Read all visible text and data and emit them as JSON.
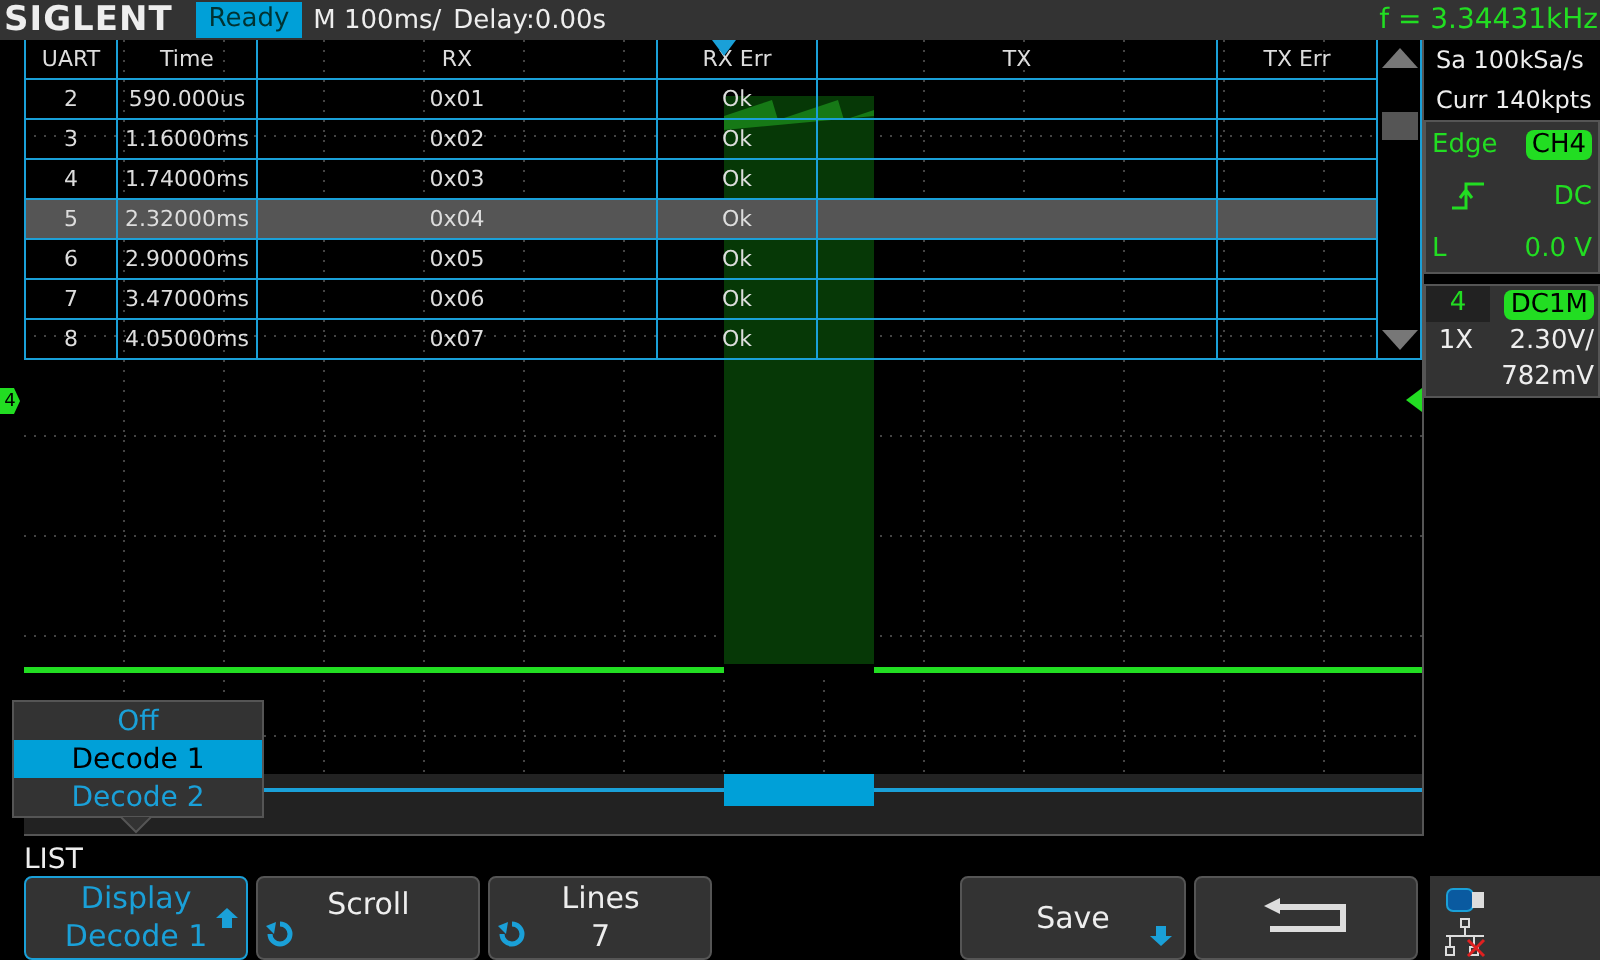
{
  "header": {
    "logo": "SIGLENT",
    "status": "Ready",
    "timebase": "M 100ms/",
    "delay": "Delay:0.00s",
    "frequency": "f = 3.34431kHz"
  },
  "table": {
    "columns": [
      "UART",
      "Time",
      "RX",
      "RX Err",
      "TX",
      "TX Err"
    ],
    "rows": [
      {
        "cells": [
          "2",
          "590.000us",
          "0x01",
          "Ok",
          "",
          ""
        ],
        "selected": false
      },
      {
        "cells": [
          "3",
          "1.16000ms",
          "0x02",
          "Ok",
          "",
          ""
        ],
        "selected": false
      },
      {
        "cells": [
          "4",
          "1.74000ms",
          "0x03",
          "Ok",
          "",
          ""
        ],
        "selected": false
      },
      {
        "cells": [
          "5",
          "2.32000ms",
          "0x04",
          "Ok",
          "",
          ""
        ],
        "selected": true
      },
      {
        "cells": [
          "6",
          "2.90000ms",
          "0x05",
          "Ok",
          "",
          ""
        ],
        "selected": false
      },
      {
        "cells": [
          "7",
          "3.47000ms",
          "0x06",
          "Ok",
          "",
          ""
        ],
        "selected": false
      },
      {
        "cells": [
          "8",
          "4.05000ms",
          "0x07",
          "Ok",
          "",
          ""
        ],
        "selected": false
      }
    ]
  },
  "channel_marker": "4",
  "acquisition": {
    "sample_rate": "Sa 100kSa/s",
    "memory": "Curr 140kpts"
  },
  "trigger": {
    "type": "Edge",
    "source": "CH4",
    "coupling": "DC",
    "level_label": "L",
    "level_value": "0.0 V"
  },
  "channel": {
    "number": "4",
    "coupling": "DC1M",
    "probe": "1X",
    "scale": "2.30V/",
    "offset": "782mV"
  },
  "popup": {
    "options": [
      {
        "label": "Off",
        "selected": false
      },
      {
        "label": "Decode 1",
        "selected": true
      },
      {
        "label": "Decode 2",
        "selected": false
      }
    ]
  },
  "menu_title": "LIST",
  "softkeys": [
    {
      "kind": "select",
      "title": "Display",
      "value": "Decode 1"
    },
    {
      "kind": "knob",
      "title": "Scroll"
    },
    {
      "kind": "knob",
      "title": "Lines",
      "value": "7"
    },
    {
      "kind": "spacer"
    },
    {
      "kind": "save",
      "title": "Save"
    },
    {
      "kind": "back"
    }
  ]
}
